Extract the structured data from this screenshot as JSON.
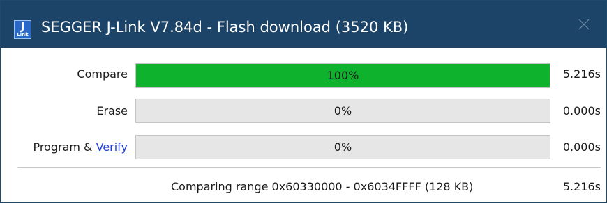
{
  "window": {
    "title": "SEGGER J-Link V7.84d - Flash download (3520 KB)",
    "icon_top": "J",
    "icon_bottom": "Link",
    "title_bar_color": "#1b4468"
  },
  "rows": [
    {
      "label": "Compare",
      "progress_text": "100%",
      "progress_fraction": 1.0,
      "time": "5.216s",
      "fill_color": "#0fb22c"
    },
    {
      "label": "Erase",
      "progress_text": "0%",
      "progress_fraction": 0.0,
      "time": "0.000s"
    },
    {
      "label_prefix": "Program & ",
      "label_link": "Verify",
      "progress_text": "0%",
      "progress_fraction": 0.0,
      "time": "0.000s"
    }
  ],
  "status": {
    "text": "Comparing range 0x60330000 - 0x6034FFFF (128 KB)",
    "time": "5.216s"
  }
}
